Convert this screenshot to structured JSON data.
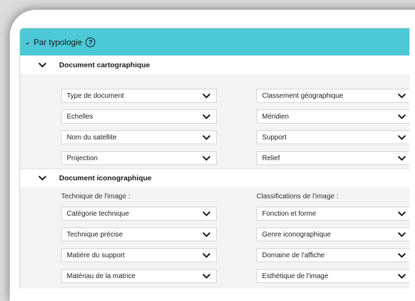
{
  "header": {
    "title": "Par typologie",
    "help_icon": "?"
  },
  "cartographique": {
    "title": "Document cartographique",
    "left": [
      "Type de document",
      "Echelles",
      "Nom du satellite",
      "Projection"
    ],
    "right": [
      "Classement géographique",
      "Méridien",
      "Support",
      "Relief"
    ]
  },
  "iconographique": {
    "title": "Document iconographique",
    "left_label": "Technique de l'image :",
    "right_label": "Classifications de l'image :",
    "left": [
      "Catégorie technique",
      "Technique précise",
      "Matière du support",
      "Matériau de la matrice"
    ],
    "right": [
      "Fonction et forme",
      "Genre iconographique",
      "Domaine de l'affiche",
      "Esthétique de l'image"
    ]
  },
  "colors": {
    "header_bg": "#4cc8d7",
    "panel_bg": "#f3f3f3"
  }
}
